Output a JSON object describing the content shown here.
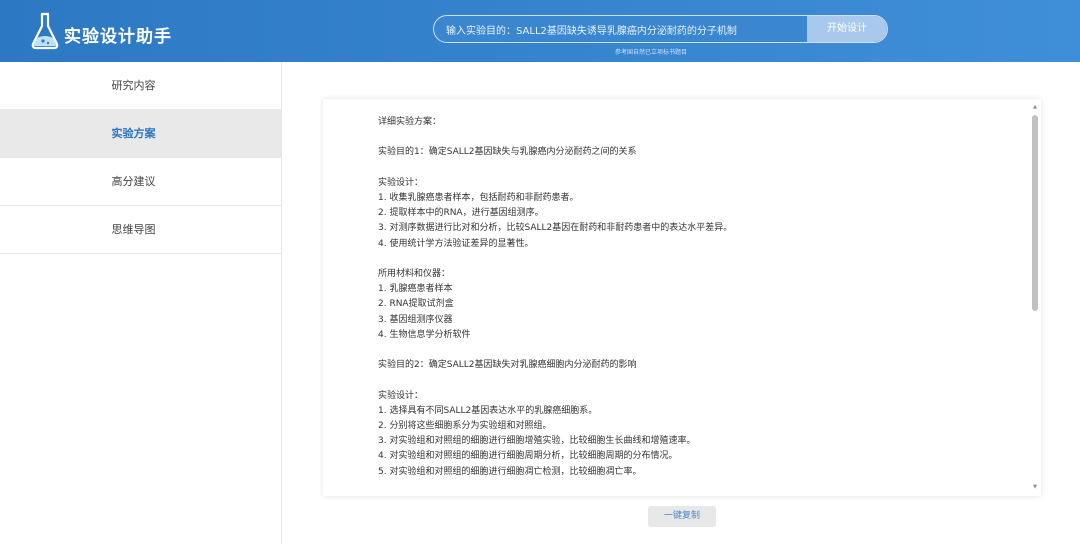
{
  "header": {
    "app_title": "实验设计助手",
    "search_value": "输入实验目的：SALL2基因缺失诱导乳腺癌内分泌耐药的分子机制",
    "start_label": "开始设计",
    "hint": "参考国自然已立项标书题目"
  },
  "sidebar": {
    "items": [
      {
        "label": "研究内容"
      },
      {
        "label": "实验方案"
      },
      {
        "label": "高分建议"
      },
      {
        "label": "思维导图"
      }
    ]
  },
  "plan": {
    "lines": [
      " 详细实验方案：",
      "",
      "实验目的1：确定SALL2基因缺失与乳腺癌内分泌耐药之间的关系",
      "",
      "实验设计：",
      "1. 收集乳腺癌患者样本，包括耐药和非耐药患者。",
      "2. 提取样本中的RNA，进行基因组测序。",
      "3. 对测序数据进行比对和分析，比较SALL2基因在耐药和非耐药患者中的表达水平差异。",
      "4. 使用统计学方法验证差异的显著性。",
      "",
      "所用材料和仪器：",
      "1. 乳腺癌患者样本",
      "2. RNA提取试剂盒",
      "3. 基因组测序仪器",
      "4. 生物信息学分析软件",
      "",
      "实验目的2：确定SALL2基因缺失对乳腺癌细胞内分泌耐药的影响",
      "",
      "实验设计：",
      "1. 选择具有不同SALL2基因表达水平的乳腺癌细胞系。",
      "2. 分别将这些细胞系分为实验组和对照组。",
      "3. 对实验组和对照组的细胞进行细胞增殖实验，比较细胞生长曲线和增殖速率。",
      "4. 对实验组和对照组的细胞进行细胞周期分析，比较细胞周期的分布情况。",
      "5. 对实验组和对照组的细胞进行细胞凋亡检测，比较细胞凋亡率。"
    ]
  },
  "actions": {
    "copy_label": "一键复制"
  }
}
